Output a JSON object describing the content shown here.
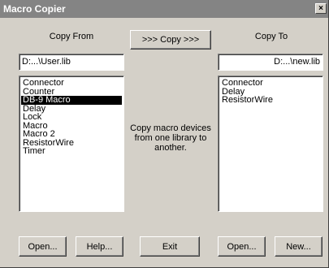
{
  "window": {
    "title": "Macro Copier",
    "close_label": "×"
  },
  "left": {
    "header": "Copy From",
    "path": "D:...\\User.lib",
    "items": [
      {
        "label": "Connector",
        "selected": false
      },
      {
        "label": "Counter",
        "selected": false
      },
      {
        "label": "DB-9 Macro",
        "selected": true
      },
      {
        "label": "Delay",
        "selected": false
      },
      {
        "label": "Lock",
        "selected": false
      },
      {
        "label": "Macro",
        "selected": false
      },
      {
        "label": "Macro 2",
        "selected": false
      },
      {
        "label": "ResistorWire",
        "selected": false
      },
      {
        "label": "Timer",
        "selected": false
      }
    ],
    "open_label": "Open...",
    "help_label": "Help..."
  },
  "center": {
    "copy_label": ">>> Copy >>>",
    "description": "Copy macro devices from one library to another.",
    "exit_label": "Exit"
  },
  "right": {
    "header": "Copy To",
    "path": "D:...\\new.lib",
    "items": [
      {
        "label": "Connector",
        "selected": false
      },
      {
        "label": "Delay",
        "selected": false
      },
      {
        "label": "ResistorWire",
        "selected": false
      }
    ],
    "open_label": "Open...",
    "new_label": "New..."
  }
}
